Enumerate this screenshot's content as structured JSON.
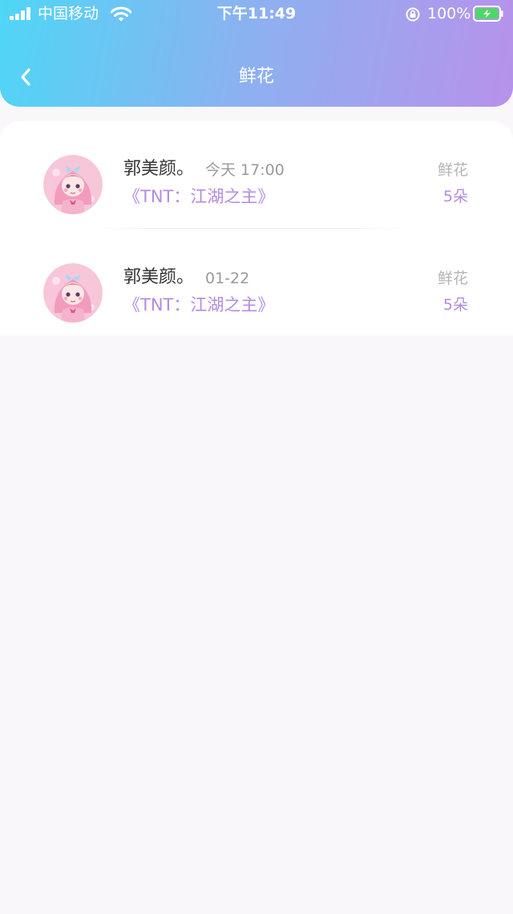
{
  "status_bar": {
    "carrier": "中国移动",
    "time": "下午11:49",
    "battery": "100%",
    "battery_level": 1.0
  },
  "nav": {
    "title": "鲜花"
  },
  "records": [
    {
      "name": "郭美颜。",
      "time": "今天 17:00",
      "book": "《TNT：江湖之主》",
      "gift_type": "鲜花",
      "gift_count": "5朵"
    },
    {
      "name": "郭美颜。",
      "time": "01-22",
      "book": "《TNT：江湖之主》",
      "gift_type": "鲜花",
      "gift_count": "5朵"
    }
  ],
  "colors": {
    "header_start": "#4fd6f6",
    "header_end": "#b792ea",
    "accent_purple": "#b48ae0",
    "background": "#f9f7f9"
  }
}
